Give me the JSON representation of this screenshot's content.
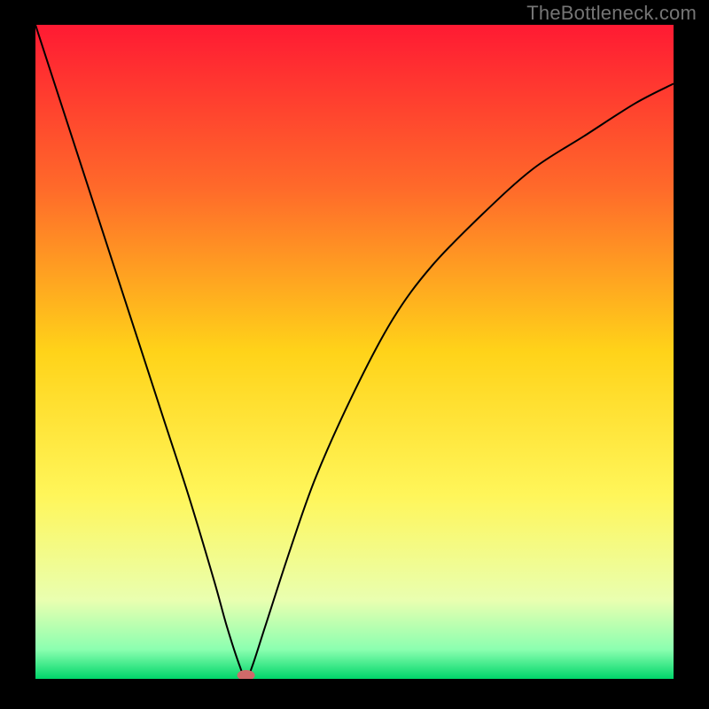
{
  "watermark": "TheBottleneck.com",
  "chart_data": {
    "type": "line",
    "title": "",
    "xlabel": "",
    "ylabel": "",
    "xlim": [
      0,
      100
    ],
    "ylim": [
      0,
      100
    ],
    "x": [
      0,
      4,
      8,
      12,
      16,
      20,
      24,
      28,
      30,
      32,
      33,
      34,
      36,
      40,
      44,
      50,
      56,
      62,
      70,
      78,
      86,
      94,
      100
    ],
    "values": [
      100,
      88,
      76,
      64,
      52,
      40,
      28,
      15,
      8,
      2,
      0,
      2,
      8,
      20,
      31,
      44,
      55,
      63,
      71,
      78,
      83,
      88,
      91
    ],
    "background_gradient": {
      "stops": [
        {
          "pos": 0.0,
          "color": "#ff1a33"
        },
        {
          "pos": 0.25,
          "color": "#ff6a2a"
        },
        {
          "pos": 0.5,
          "color": "#ffd319"
        },
        {
          "pos": 0.72,
          "color": "#fff65a"
        },
        {
          "pos": 0.88,
          "color": "#e9ffb0"
        },
        {
          "pos": 0.955,
          "color": "#8bffb0"
        },
        {
          "pos": 1.0,
          "color": "#00d66a"
        }
      ]
    },
    "marker": {
      "x": 33,
      "y": 0,
      "color": "#cf6a6a"
    },
    "curve_color": "#000000",
    "curve_width": 2
  }
}
